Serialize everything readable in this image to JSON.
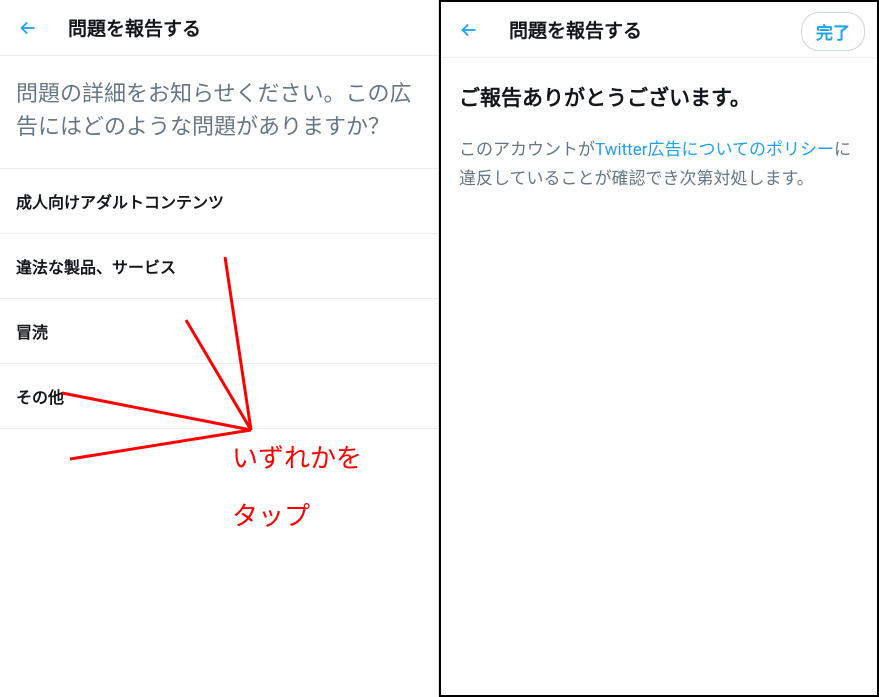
{
  "left": {
    "header": {
      "title": "問題を報告する"
    },
    "prompt": "問題の詳細をお知らせください。この広告にはどのような問題がありますか？",
    "options": [
      "成人向けアダルトコンテンツ",
      "違法な製品、サービス",
      "冒涜",
      "その他"
    ],
    "annotation": {
      "line1": "いずれかを",
      "line2": "タップ"
    }
  },
  "right": {
    "header": {
      "title": "問題を報告する",
      "done": "完了"
    },
    "thanks_title": "ご報告ありがとうございます。",
    "body_prefix": "このアカウントが",
    "policy_link": "Twitter広告についてのポリシー",
    "body_suffix": "に違反していることが確認でき次第対処します。"
  }
}
